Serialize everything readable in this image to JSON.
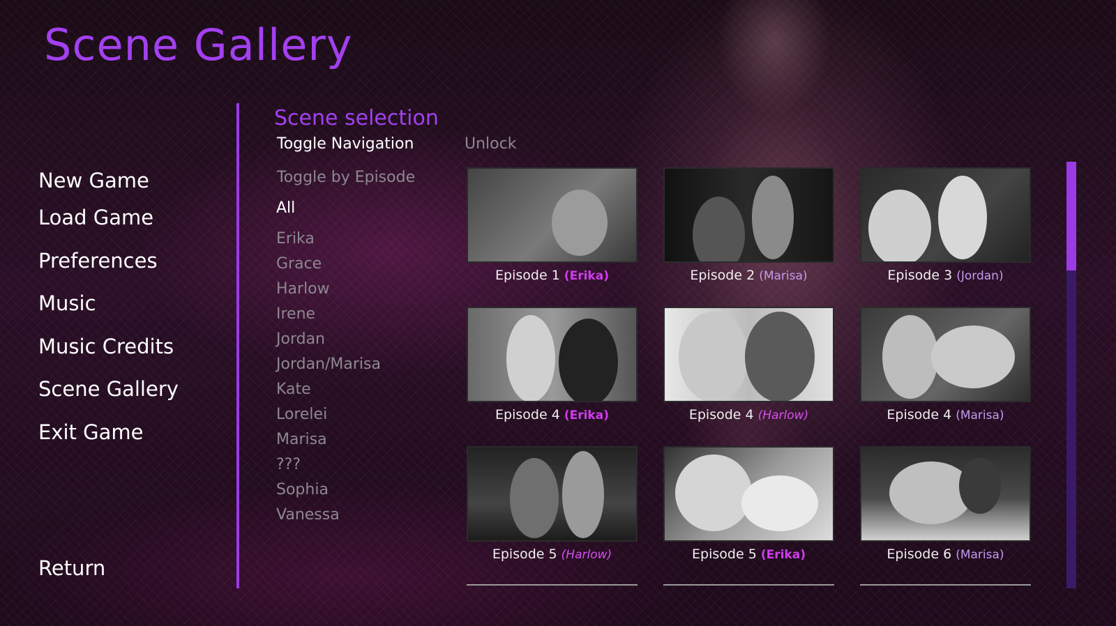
{
  "title": "Scene Gallery",
  "main_menu": [
    {
      "label": "New Game"
    },
    {
      "label": "Load Game"
    },
    {
      "label": "Preferences"
    },
    {
      "label": "Music"
    },
    {
      "label": "Music Credits"
    },
    {
      "label": "Scene Gallery"
    },
    {
      "label": "Exit Game"
    }
  ],
  "return_label": "Return",
  "section_title": "Scene selection",
  "toggle_navigation": "Toggle Navigation",
  "unlock": "Unlock",
  "toggle_by_episode": "Toggle by Episode",
  "characters": [
    "All",
    "Erika",
    "Grace",
    "Harlow",
    "Irene",
    "Jordan",
    "Jordan/Marisa",
    "Kate",
    "Lorelei",
    "Marisa",
    "???",
    "Sophia",
    "Vanessa"
  ],
  "selected_character": "All",
  "scenes": [
    {
      "episode": "Episode 1",
      "who": "(Erika)"
    },
    {
      "episode": "Episode 2",
      "who": "(Marisa)"
    },
    {
      "episode": "Episode 3",
      "who": "(Jordan)"
    },
    {
      "episode": "Episode 4",
      "who": "(Erika)"
    },
    {
      "episode": "Episode 4",
      "who": "(Harlow)"
    },
    {
      "episode": "Episode 4",
      "who": "(Marisa)"
    },
    {
      "episode": "Episode 5",
      "who": "(Harlow)"
    },
    {
      "episode": "Episode 5",
      "who": "(Erika)"
    },
    {
      "episode": "Episode 6",
      "who": "(Marisa)"
    }
  ],
  "colors": {
    "accent": "#a340f0",
    "erika": "#d13cf0",
    "marisa": "#c39cf0",
    "harlow": "#d64ff2"
  }
}
